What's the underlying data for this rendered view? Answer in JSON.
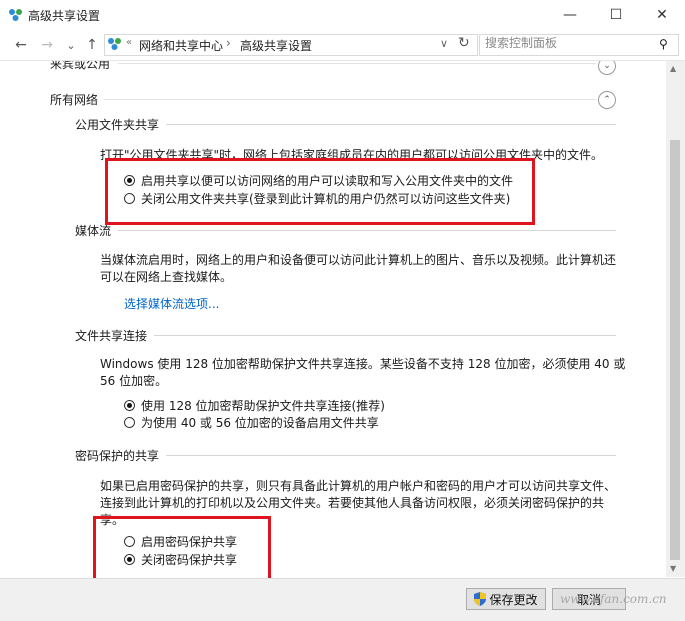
{
  "window": {
    "title": "高级共享设置",
    "min_glyph": "—",
    "max_glyph": "☐",
    "close_glyph": "✕"
  },
  "address": {
    "back_glyph": "←",
    "fwd_glyph": "→",
    "dd_glyph": "⌄",
    "up_glyph": "↑",
    "sep_glyph": "«",
    "crumbs": [
      "网络和共享中心",
      "高级共享设置"
    ],
    "crumb_arrow": "›",
    "addr_dropdown": "∨",
    "refresh_glyph": "↻",
    "search_placeholder": "搜索控制面板",
    "search_glyph": "⚲"
  },
  "content": {
    "prev_section": "来宾或公用",
    "group_title": "所有网络",
    "public_folder": {
      "heading": "公用文件夹共享",
      "desc": "打开\"公用文件夹共享\"时，网络上包括家庭组成员在内的用户都可以访问公用文件夹中的文件。",
      "opt_on": "启用共享以便可以访问网络的用户可以读取和写入公用文件夹中的文件",
      "opt_off": "关闭公用文件夹共享(登录到此计算机的用户仍然可以访问这些文件夹)"
    },
    "media": {
      "heading": "媒体流",
      "desc1": "当媒体流启用时，网络上的用户和设备便可以访问此计算机上的图片、音乐以及视频。此计算机还",
      "desc2": "可以在网络上查找媒体。",
      "link": "选择媒体流选项..."
    },
    "file_conn": {
      "heading": "文件共享连接",
      "desc1": "Windows 使用 128 位加密帮助保护文件共享连接。某些设备不支持 128 位加密，必须使用 40 或",
      "desc2": "56 位加密。",
      "opt128": "使用 128 位加密帮助保护文件共享连接(推荐)",
      "opt40": "为使用 40 或 56 位加密的设备启用文件共享"
    },
    "password": {
      "heading": "密码保护的共享",
      "desc1": "如果已启用密码保护的共享，则只有具备此计算机的用户帐户和密码的用户才可以访问共享文件、",
      "desc2": "连接到此计算机的打印机以及公用文件夹。若要使其他人具备访问权限，必须关闭密码保护的共",
      "desc3": "享。",
      "opt_on": "启用密码保护共享",
      "opt_off": "关闭密码保护共享"
    }
  },
  "footer": {
    "save": "保存更改",
    "cancel": "取消",
    "watermark": "www.cfan.com.cn"
  },
  "state": {
    "public_folder_selected": "opt_on",
    "file_conn_selected": "opt128",
    "password_selected": "opt_off"
  },
  "colors": {
    "accent_red": "#e0141e",
    "link_blue": "#0066cc"
  }
}
